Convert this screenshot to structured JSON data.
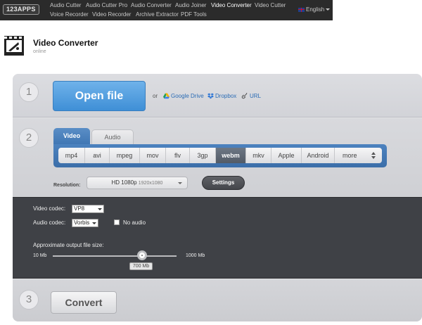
{
  "nav": {
    "logo": "123APPS",
    "items": [
      "Audio Cutter",
      "Audio Cutter Pro",
      "Audio Converter",
      "Audio Joiner",
      "Video Converter",
      "Video Cutter",
      "Voice Recorder",
      "Video Recorder",
      "Archive Extractor",
      "PDF Tools"
    ],
    "active": "Video Converter",
    "language": "English"
  },
  "app": {
    "title": "Video Converter",
    "subtitle": "online"
  },
  "step1": {
    "number": "1",
    "open_button": "Open file",
    "or": "or",
    "sources": [
      "Google Drive",
      "Dropbox",
      "URL"
    ]
  },
  "step2": {
    "number": "2",
    "tabs": [
      "Video",
      "Audio"
    ],
    "active_tab": "Video",
    "formats": [
      "mp4",
      "avi",
      "mpeg",
      "mov",
      "flv",
      "3gp",
      "webm",
      "mkv",
      "Apple",
      "Android",
      "more"
    ],
    "selected_format": "webm",
    "resolution_label": "Resolution:",
    "resolution_value": "HD 1080p",
    "resolution_size": "1920x1080",
    "settings_button": "Settings"
  },
  "settings": {
    "video_codec_label": "Video codec:",
    "video_codec": "VP8",
    "audio_codec_label": "Audio codec:",
    "audio_codec": "Vorbis",
    "no_audio_label": "No audio",
    "no_audio_checked": false,
    "size_label": "Approximate output file size:",
    "size_min": "10 Mb",
    "size_max": "1000 Mb",
    "size_value": "700 Mb"
  },
  "step3": {
    "number": "3",
    "convert_button": "Convert"
  },
  "colors": {
    "topbar": "#2b2b2b",
    "accent_blue": "#4c82bf",
    "open_button": "#4f9ee0",
    "dark_panel": "#3f4146",
    "link": "#2a6bb5"
  }
}
